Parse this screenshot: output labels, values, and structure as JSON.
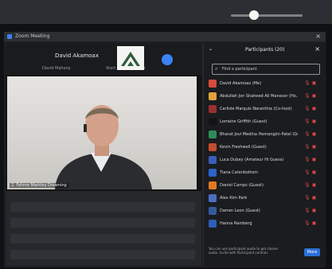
{
  "window": {
    "title": "Zoom Meeting",
    "close_glyph": "×"
  },
  "tile": {
    "name": "David Akamoax",
    "subtitle_left": "David Mahony",
    "subtitle_right": "Start co-Ho a nisme"
  },
  "video": {
    "label": "2. Fahme Markley Drowning"
  },
  "panel": {
    "title": "Participants (20)",
    "search_placeholder": "Find a participant",
    "participants": [
      {
        "name": "David Akamoax (Me)",
        "color": "#d94a3d"
      },
      {
        "name": "Abdullah Jon Shaheed Ali Mansoor (Ho...) · Muted",
        "color": "#e0a23c"
      },
      {
        "name": "Carlisle Marquis Naranthia (Co-host)",
        "color": "#9a2f2f"
      },
      {
        "name": "Lorraine Griffith (Guest)",
        "color": "#141414"
      },
      {
        "name": "Bharat Jovi Medina Hemangini-Patel (Guest)",
        "color": "#2e8b57"
      },
      {
        "name": "Kevin Freshwell (Guest)",
        "color": "#c44c2e"
      },
      {
        "name": "Luca Dubey (Amateur Hi Guess)",
        "color": "#3a5fb8"
      },
      {
        "name": "Tiana Catenbottom",
        "color": "#2a63c8"
      },
      {
        "name": "Daniel Camps (Guest)",
        "color": "#e07a24"
      },
      {
        "name": "Alex Kim Park",
        "color": "#4b6fc2"
      },
      {
        "name": "Darren Leon (Guest)",
        "color": "#355a9c"
      },
      {
        "name": "Hanna Ramberg",
        "color": "#2b5fb7"
      }
    ]
  },
  "footer": {
    "line1": "You can use participant audio to get clearer",
    "line2": "audio. Invite with Participant controls"
  },
  "buttons": {
    "invite": "More"
  },
  "icons": {
    "mic_glyph": "🎙",
    "cam_glyph": "◼",
    "search_glyph": "⌕",
    "chevron_glyph": "⌄"
  }
}
